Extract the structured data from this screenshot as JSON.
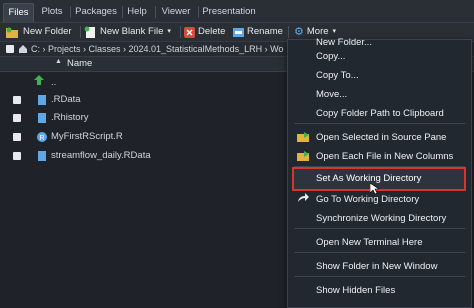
{
  "tabs": [
    {
      "label": "Files",
      "active": true
    },
    {
      "label": "Plots"
    },
    {
      "label": "Packages"
    },
    {
      "label": "Help"
    },
    {
      "label": "Viewer"
    },
    {
      "label": "Presentation"
    }
  ],
  "toolbar": {
    "new_folder": "New Folder",
    "new_blank_file": "New Blank File",
    "delete": "Delete",
    "rename": "Rename",
    "more": "More"
  },
  "breadcrumb": {
    "path": "C: › Projects › Classes › 2024.01_StatisticalMethods_LRH › Wo"
  },
  "file_list": {
    "header": "Name",
    "parent": "..",
    "files": [
      ".RData",
      ".Rhistory",
      "MyFirstRScript.R",
      "streamflow_daily.RData"
    ]
  },
  "menu": {
    "items": [
      "New Folder...",
      "Copy...",
      "Copy To...",
      "Move...",
      "Copy Folder Path to Clipboard",
      "Open Selected in Source Pane",
      "Open Each File in New Columns",
      "Set As Working Directory",
      "Go To Working Directory",
      "Synchronize Working Directory",
      "Open New Terminal Here",
      "Show Folder in New Window",
      "Show Hidden Files"
    ]
  },
  "colors": {
    "accent": "#d9342b",
    "background": "#1f2329",
    "menu_bg": "#222830"
  }
}
